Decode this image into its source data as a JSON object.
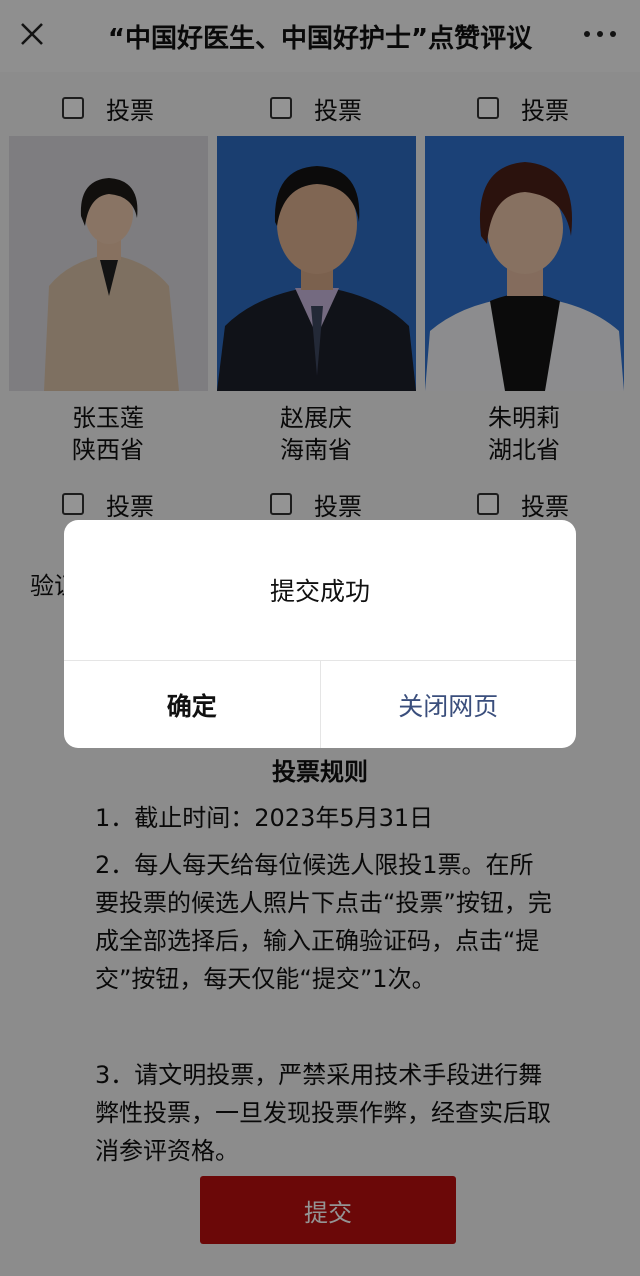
{
  "header": {
    "title": "“中国好医生、中国好护士”点赞评议"
  },
  "vote_label": "投票",
  "candidates": [
    {
      "name": "张玉莲",
      "province": "陕西省"
    },
    {
      "name": "赵展庆",
      "province": "海南省"
    },
    {
      "name": "朱明莉",
      "province": "湖北省"
    }
  ],
  "captcha": {
    "label": "验证"
  },
  "rules": {
    "title": "投票规则",
    "items": [
      "1．截止时间：2023年5月31日",
      "2．每人每天给每位候选人限投1票。在所要投票的候选人照片下点击“投票”按钮，完成全部选择后，输入正确验证码，点击“提交”按钮，每天仅能“提交”1次。",
      "3．请文明投票，严禁采用技术手段进行舞弊性投票，一旦发现投票作弊，经查实后取消参评资格。"
    ]
  },
  "submit_label": "提交",
  "dialog": {
    "message": "提交成功",
    "confirm_label": "确定",
    "close_page_label": "关闭网页"
  },
  "colors": {
    "submit": "#b80f0f",
    "link": "#3a4e7c"
  }
}
